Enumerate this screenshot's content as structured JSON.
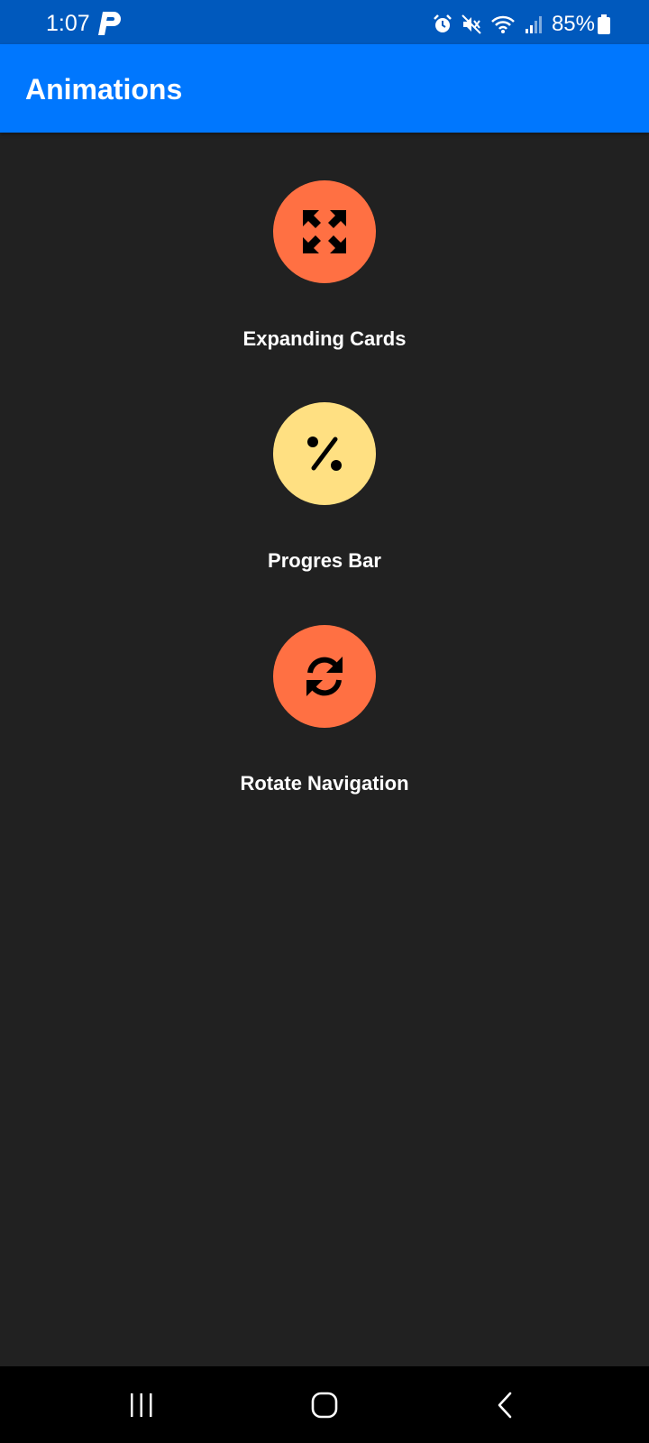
{
  "status_bar": {
    "time": "1:07",
    "battery": "85%",
    "icons": [
      "p-app-icon",
      "alarm-icon",
      "mute-icon",
      "wifi-icon",
      "signal-icon",
      "battery-icon"
    ]
  },
  "app_bar": {
    "title": "Animations"
  },
  "menu": [
    {
      "label": "Expanding Cards",
      "icon": "expand-arrows-icon",
      "color": "#ff7043"
    },
    {
      "label": "Progres Bar",
      "icon": "percent-icon",
      "color": "#ffe082"
    },
    {
      "label": "Rotate Navigation",
      "icon": "sync-icon",
      "color": "#ff7043"
    }
  ],
  "nav_bar": {
    "buttons": [
      "recent-apps-icon",
      "home-icon",
      "back-icon"
    ]
  },
  "colors": {
    "background": "#212121",
    "app_bar": "#0077fe",
    "status_bar": "#0059bd",
    "accent_orange": "#ff7043",
    "accent_yellow": "#ffe082"
  }
}
